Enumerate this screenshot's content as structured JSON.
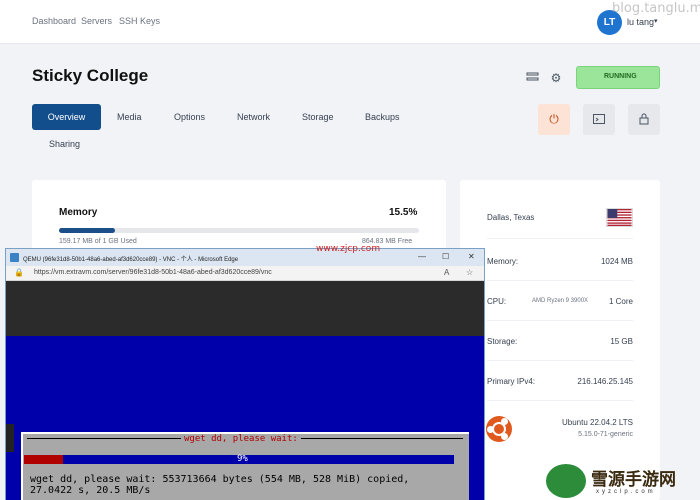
{
  "nav": {
    "items": [
      "Dashboard",
      "Servers",
      "SSH Keys"
    ]
  },
  "user": {
    "initials": "LT",
    "name": "lu tang",
    "caret": "▾"
  },
  "watermark": {
    "top": "blog.tanglu.me",
    "zjcp": "www.zjcp.com",
    "logo": "雪源手游网",
    "logo_sub": "xyzclp.com"
  },
  "server": {
    "title": "Sticky College",
    "status": "RUNNING",
    "status_color": "#9be59b"
  },
  "header_icons": [
    "list-icon",
    "gear-icon"
  ],
  "tabs": [
    "Overview",
    "Media",
    "Options",
    "Network",
    "Storage",
    "Backups",
    "Sharing"
  ],
  "actions": [
    "power-icon",
    "console-icon",
    "lock-icon"
  ],
  "memory": {
    "title": "Memory",
    "percent": "15.5%",
    "fill": 0.155,
    "used": "159.17 MB of 1 GB Used",
    "free": "864.83 MB Free"
  },
  "info": {
    "location": "Dallas, Texas",
    "memory_label": "Memory:",
    "memory_value": "1024 MB",
    "cpu_label": "CPU:",
    "cpu_model": "AMD Ryzen 9 3900X",
    "cpu_cores": "1 Core",
    "storage_label": "Storage:",
    "storage_value": "15 GB",
    "ip_label": "Primary IPv4:",
    "ip_value": "216.146.25.145",
    "os_name": "Ubuntu 22.04.2 LTS",
    "os_kernel": "5.15.0-71-generic"
  },
  "vnc": {
    "title": "QEMU (96fe31d8-50b1-48a6-abed-af3d620cce89) - VNC - 个人 - Microsoft Edge",
    "url": "https://vm.extravm.com/server/96fe31d8-50b1-48a6-abed-af3d620cce89/vnc",
    "dialog_title": "wget dd, please wait:",
    "progress_pct": "9%",
    "progress_fill": 0.09,
    "line1": "wget dd, please wait: 553713664 bytes (554 MB, 528 MiB) copied,",
    "line2": "27.0422 s, 20.5 MB/s"
  }
}
